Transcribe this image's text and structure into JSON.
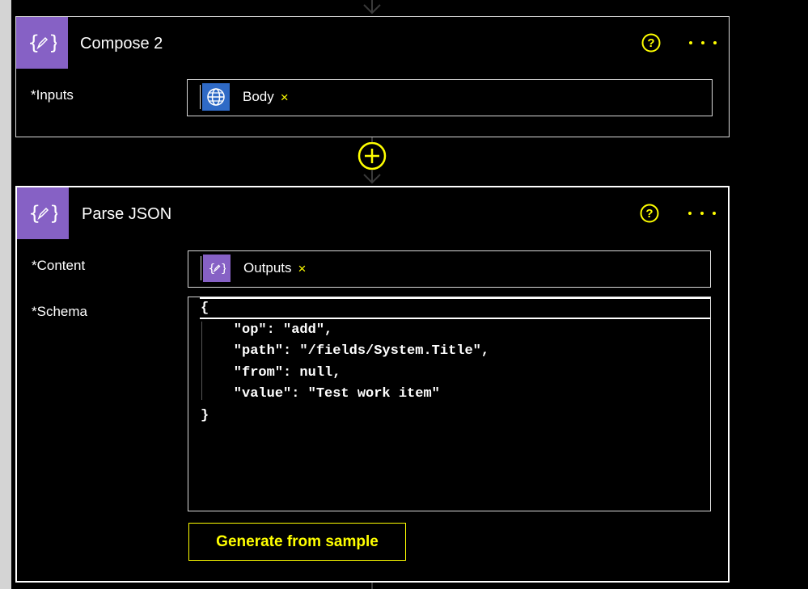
{
  "compose": {
    "title": "Compose 2",
    "icon": "compose-curly-edit-icon",
    "inputs_label": "Inputs",
    "required_marker": "*",
    "token_label": "Body",
    "token_icon": "globe-icon",
    "token_remove": "×"
  },
  "insert_step": {
    "icon": "plus-circle-icon"
  },
  "parse_json": {
    "title": "Parse JSON",
    "icon": "compose-curly-edit-icon",
    "content_label": "Content",
    "schema_label": "Schema",
    "required_marker": "*",
    "content_token_label": "Outputs",
    "content_token_icon": "compose-curly-edit-icon",
    "content_token_remove": "×",
    "schema_lines": [
      "{",
      "    \"op\": \"add\",",
      "    \"path\": \"/fields/System.Title\",",
      "    \"from\": null,",
      "    \"value\": \"Test work item\"",
      "}"
    ],
    "generate_button_label": "Generate from sample"
  },
  "colors": {
    "accent": "#ffff00",
    "action_purple": "#8661c5",
    "http_blue": "#2f6ac6",
    "background": "#000000"
  }
}
